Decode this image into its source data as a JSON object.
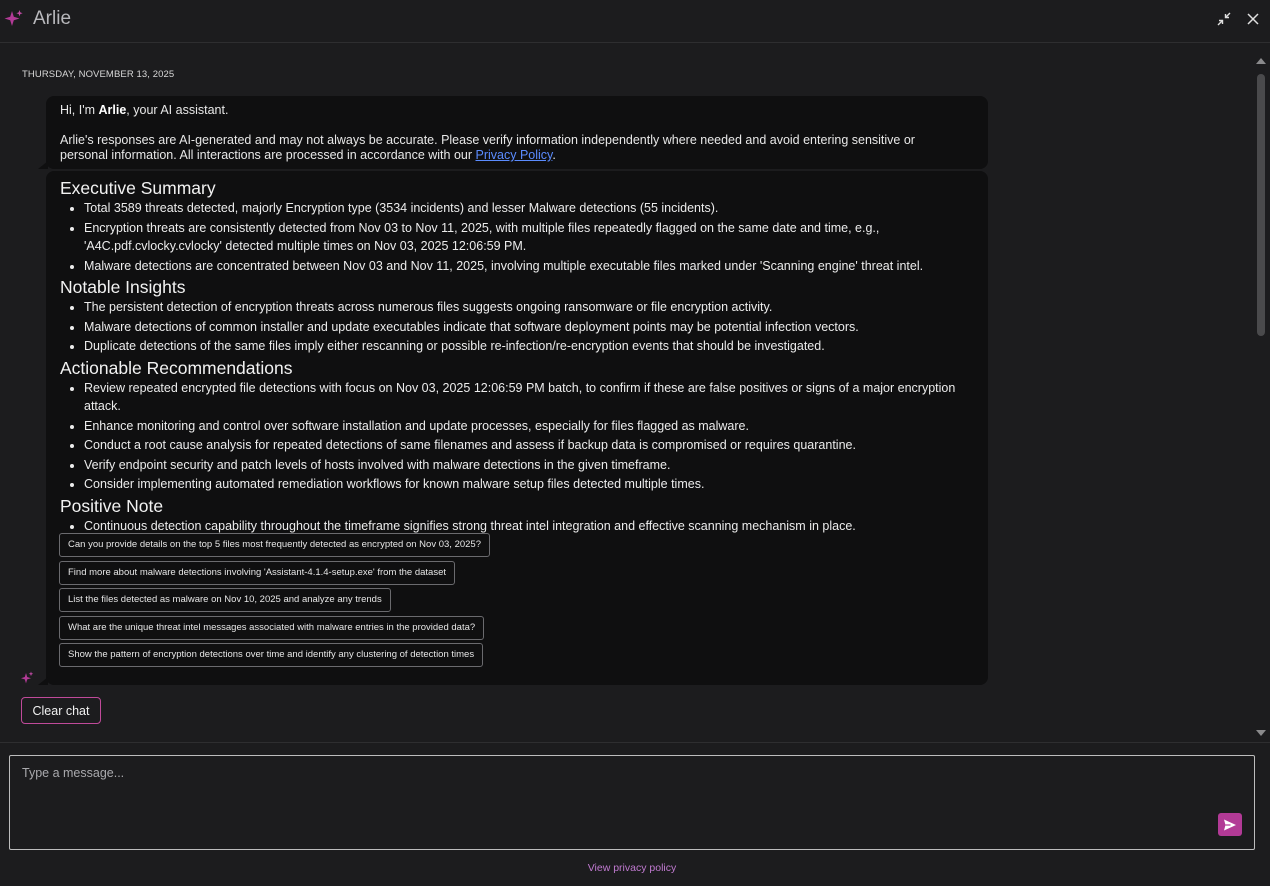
{
  "header": {
    "title": "Arlie"
  },
  "conversation": {
    "date": "THURSDAY, NOVEMBER 13, 2025",
    "greeting": {
      "prefix": "Hi, I'm ",
      "name": "Arlie",
      "suffix": ", your AI assistant."
    },
    "disclaimer": {
      "text": "Arlie's responses are AI-generated and may not always be accurate. Please verify information independently where needed and avoid entering sensitive or personal information. All interactions are processed in accordance with our ",
      "link": "Privacy Policy",
      "end": "."
    },
    "response": {
      "sections": [
        {
          "heading": "Executive Summary",
          "items": [
            "Total 3589 threats detected, majorly Encryption type (3534 incidents) and lesser Malware detections (55 incidents).",
            "Encryption threats are consistently detected from Nov 03 to Nov 11, 2025, with multiple files repeatedly flagged on the same date and time, e.g., 'A4C.pdf.cvlocky.cvlocky' detected multiple times on Nov 03, 2025 12:06:59 PM.",
            "Malware detections are concentrated between Nov 03 and Nov 11, 2025, involving multiple executable files marked under 'Scanning engine' threat intel."
          ]
        },
        {
          "heading": "Notable Insights",
          "items": [
            "The persistent detection of encryption threats across numerous files suggests ongoing ransomware or file encryption activity.",
            "Malware detections of common installer and update executables indicate that software deployment points may be potential infection vectors.",
            "Duplicate detections of the same files imply either rescanning or possible re-infection/re-encryption events that should be investigated."
          ]
        },
        {
          "heading": "Actionable Recommendations",
          "items": [
            "Review repeated encrypted file detections with focus on Nov 03, 2025 12:06:59 PM batch, to confirm if these are false positives or signs of a major encryption attack.",
            "Enhance monitoring and control over software installation and update processes, especially for files flagged as malware.",
            "Conduct a root cause analysis for repeated detections of same filenames and assess if backup data is compromised or requires quarantine.",
            "Verify endpoint security and patch levels of hosts involved with malware detections in the given timeframe.",
            "Consider implementing automated remediation workflows for known malware setup files detected multiple times."
          ]
        },
        {
          "heading": "Positive Note",
          "items": [
            "Continuous detection capability throughout the timeframe signifies strong threat intel integration and effective scanning mechanism in place."
          ]
        }
      ],
      "suggestions": [
        "Can you provide details on the top 5 files most frequently detected as encrypted on Nov 03, 2025?",
        "Find more about malware detections involving 'Assistant-4.1.4-setup.exe' from the dataset",
        "List the files detected as malware on Nov 10, 2025 and analyze any trends",
        "What are the unique threat intel messages associated with malware entries in the provided data?",
        "Show the pattern of encryption detections over time and identify any clustering of detection times"
      ]
    },
    "clear_label": "Clear chat"
  },
  "composer": {
    "placeholder": "Type a message...",
    "privacy_link": "View privacy policy"
  },
  "colors": {
    "accent": "#b23a96",
    "link": "#5b8cff",
    "privacy_link": "#c07ad0",
    "background": "#1c1c1e",
    "bubble": "#0f0f10"
  },
  "icons": [
    "sparkle-logo-icon",
    "minimize-icon",
    "close-icon",
    "send-icon",
    "scroll-up-icon",
    "scroll-down-icon"
  ]
}
